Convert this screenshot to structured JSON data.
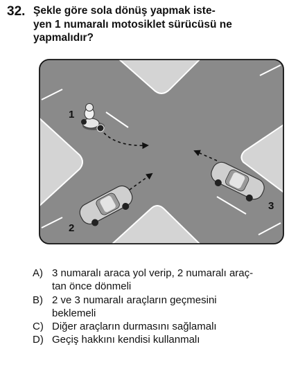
{
  "question": {
    "number": "32.",
    "lines": [
      "Şekle göre sola dönüş yapmak iste-",
      "yen 1 numaralı motosiklet sürücüsü ne",
      "yapmalıdır?"
    ]
  },
  "figure": {
    "labels": {
      "motorcycle": "1",
      "car_bottom": "2",
      "car_right": "3"
    },
    "colors": {
      "road": "#8a8a8a",
      "sidewalk": "#d9d9d9",
      "lane_mark": "#ffffff",
      "car": "#cfcfcf"
    }
  },
  "options": [
    {
      "letter": "A)",
      "lines": [
        "3 numaralı araca yol verip, 2 numaralı araç-",
        "tan önce dönmeli"
      ]
    },
    {
      "letter": "B)",
      "lines": [
        "2 ve 3 numaralı araçların geçmesini",
        "beklemeli"
      ]
    },
    {
      "letter": "C)",
      "lines": [
        "Diğer araçların durmasını sağlamalı"
      ]
    },
    {
      "letter": "D)",
      "lines": [
        "Geçiş hakkını kendisi kullanmalı"
      ]
    }
  ]
}
